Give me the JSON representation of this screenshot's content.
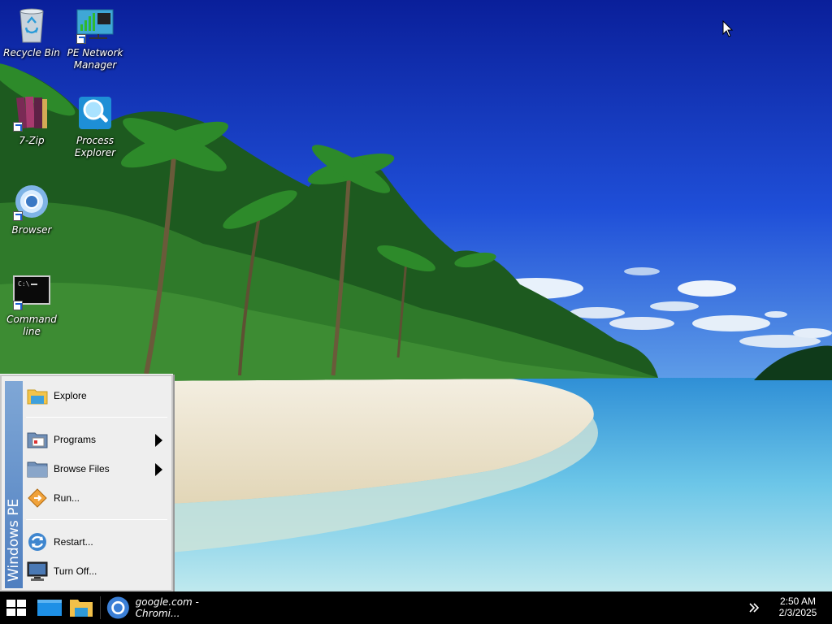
{
  "desktop": {
    "icons": [
      {
        "label": "Recycle Bin",
        "icon": "recycle-bin-icon"
      },
      {
        "label": "PE Network Manager",
        "icon": "network-manager-icon"
      },
      {
        "label": "7-Zip",
        "icon": "7zip-icon"
      },
      {
        "label": "Process Explorer",
        "icon": "process-explorer-icon"
      },
      {
        "label": "Browser",
        "icon": "browser-icon"
      },
      {
        "label": "Command line",
        "icon": "command-line-icon"
      }
    ]
  },
  "start_menu": {
    "band_text": "Windows PE",
    "items": [
      {
        "label": "Explore",
        "icon": "folder-icon",
        "submenu": false
      },
      {
        "label": "Programs",
        "icon": "programs-folder-icon",
        "submenu": true
      },
      {
        "label": "Browse Files",
        "icon": "browse-folder-icon",
        "submenu": true
      },
      {
        "label": "Run...",
        "icon": "run-icon",
        "submenu": false
      },
      {
        "label": "Restart...",
        "icon": "restart-icon",
        "submenu": false
      },
      {
        "label": "Turn Off...",
        "icon": "turn-off-icon",
        "submenu": false
      }
    ]
  },
  "taskbar": {
    "start_icon": "windows-logo-icon",
    "pinned": [
      {
        "icon": "desktop-icon"
      },
      {
        "icon": "file-explorer-icon"
      }
    ],
    "task": {
      "label": "google.com - Chromi...",
      "icon": "chromium-icon"
    },
    "overflow_icon": "chevron-right-icon",
    "clock": {
      "time": "2:50 AM",
      "date": "2/3/2025"
    }
  },
  "colors": {
    "taskbar": "#000000",
    "menu_band": "#5b86c6",
    "menu_bg": "#eeeeee",
    "sky": "#0b2bb8"
  }
}
